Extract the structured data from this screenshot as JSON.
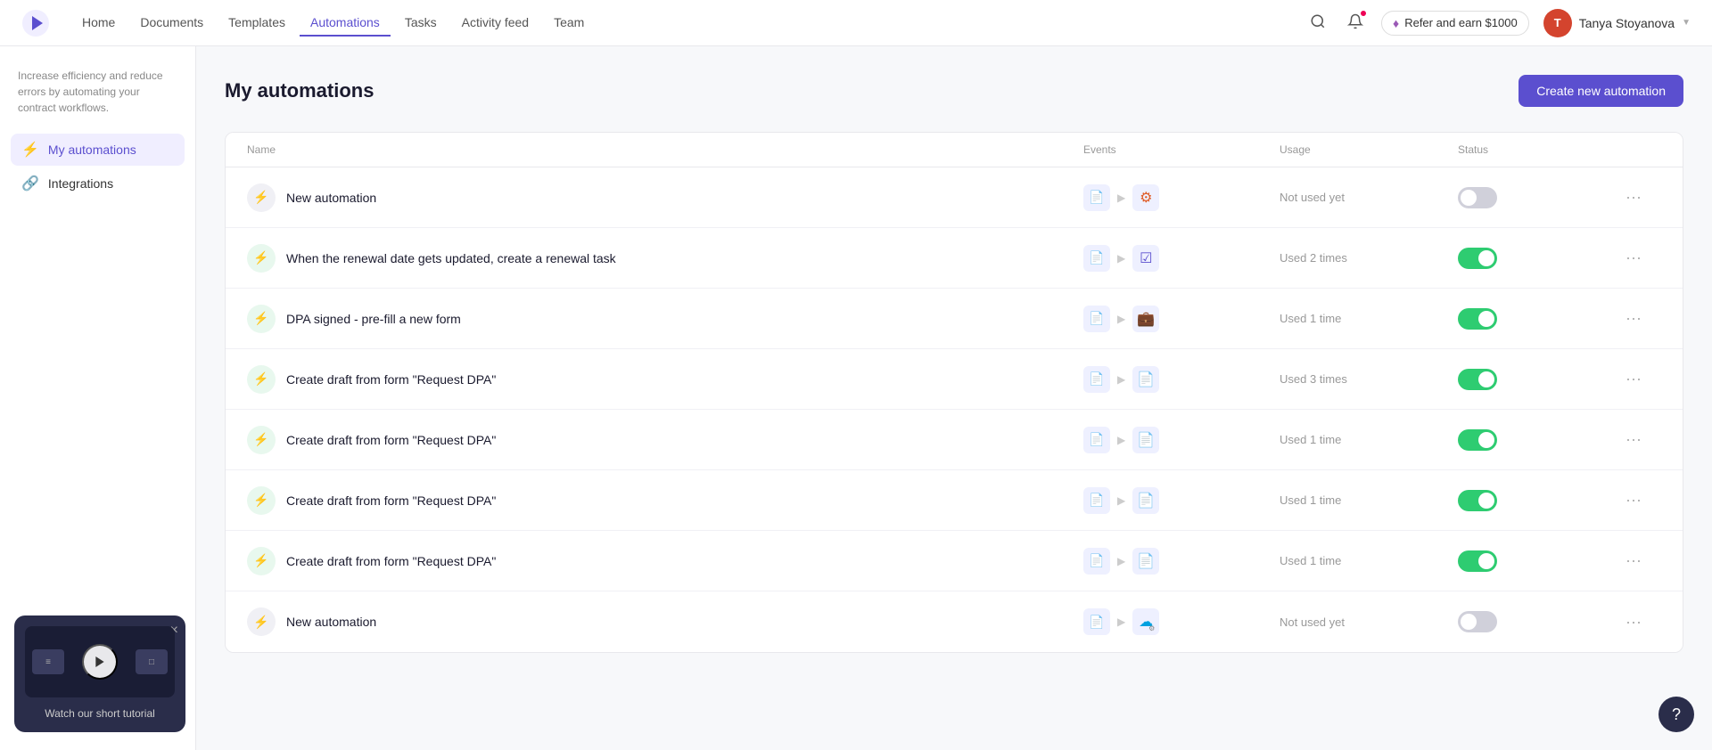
{
  "nav": {
    "links": [
      {
        "label": "Home",
        "active": false
      },
      {
        "label": "Documents",
        "active": false
      },
      {
        "label": "Templates",
        "active": false
      },
      {
        "label": "Automations",
        "active": true
      },
      {
        "label": "Tasks",
        "active": false
      },
      {
        "label": "Activity feed",
        "active": false
      },
      {
        "label": "Team",
        "active": false
      }
    ],
    "refer_label": "Refer and earn $1000",
    "user_name": "Tanya Stoyanova",
    "user_initials": "T"
  },
  "sidebar": {
    "description": "Increase efficiency and reduce errors by automating your contract workflows.",
    "items": [
      {
        "id": "my-automations",
        "label": "My automations",
        "icon": "⚡",
        "active": true
      },
      {
        "id": "integrations",
        "label": "Integrations",
        "icon": "🔗",
        "active": false
      }
    ]
  },
  "page": {
    "title": "My automations",
    "create_btn": "Create new automation"
  },
  "table": {
    "headers": [
      "Name",
      "Events",
      "Usage",
      "Status",
      ""
    ],
    "rows": [
      {
        "id": 1,
        "name": "New automation",
        "icon_active": false,
        "events_trigger": "doc",
        "events_target_type": "hubspot",
        "usage": "Not used yet",
        "status": false
      },
      {
        "id": 2,
        "name": "When the renewal date gets updated, create a renewal task",
        "icon_active": true,
        "events_trigger": "doc",
        "events_target_type": "checkbox",
        "usage": "Used 2 times",
        "status": true
      },
      {
        "id": 3,
        "name": "DPA signed - pre-fill a new form",
        "icon_active": true,
        "events_trigger": "doc",
        "events_target_type": "briefcase",
        "usage": "Used 1 time",
        "status": true
      },
      {
        "id": 4,
        "name": "Create draft from form \"Request DPA\"",
        "icon_active": true,
        "events_trigger": "doc",
        "events_target_type": "doc",
        "usage": "Used 3 times",
        "status": true
      },
      {
        "id": 5,
        "name": "Create draft from form \"Request DPA\"",
        "icon_active": true,
        "events_trigger": "doc",
        "events_target_type": "doc",
        "usage": "Used 1 time",
        "status": true
      },
      {
        "id": 6,
        "name": "Create draft from form \"Request DPA\"",
        "icon_active": true,
        "events_trigger": "doc",
        "events_target_type": "doc",
        "usage": "Used 1 time",
        "status": true
      },
      {
        "id": 7,
        "name": "Create draft from form \"Request DPA\"",
        "icon_active": true,
        "events_trigger": "doc",
        "events_target_type": "doc",
        "usage": "Used 1 time",
        "status": true
      },
      {
        "id": 8,
        "name": "New automation",
        "icon_active": false,
        "events_trigger": "doc",
        "events_target_type": "salesforce",
        "usage": "Not used yet",
        "status": false
      }
    ]
  },
  "tutorial": {
    "label": "Watch our short tutorial",
    "close_label": "×"
  },
  "help": {
    "label": "?"
  }
}
